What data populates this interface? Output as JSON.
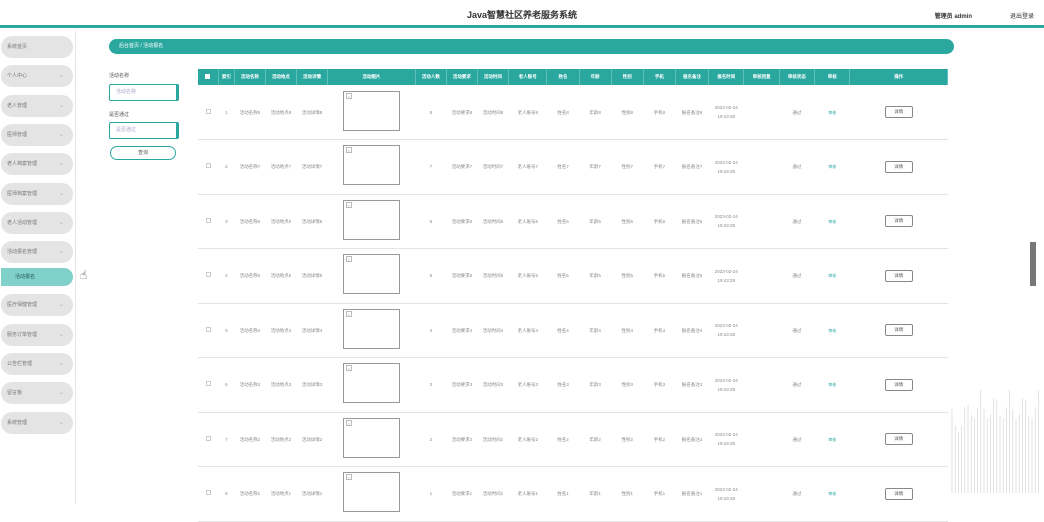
{
  "header": {
    "title": "Java智慧社区养老服务系统",
    "user": "管理员 admin",
    "logout": "退出登录"
  },
  "sidebar": {
    "items": [
      {
        "label": "系统首页",
        "chev": ""
      },
      {
        "label": "个人中心",
        "chev": "⌄"
      },
      {
        "label": "老人管理",
        "chev": "⌄"
      },
      {
        "label": "医师管理",
        "chev": "⌄"
      },
      {
        "label": "老人档案管理",
        "chev": "⌄"
      },
      {
        "label": "医师档案管理",
        "chev": "⌄"
      },
      {
        "label": "老人活动管理",
        "chev": "⌄"
      },
      {
        "label": "活动报名管理",
        "chev": "⌄"
      }
    ],
    "active_sub": "活动报名",
    "items_after": [
      {
        "label": "医疗保健管理",
        "chev": "⌄"
      },
      {
        "label": "服务订单管理",
        "chev": "⌄"
      },
      {
        "label": "公告栏管理",
        "chev": "⌄"
      },
      {
        "label": "留言板",
        "chev": "⌄"
      },
      {
        "label": "系统管理",
        "chev": "⌄"
      }
    ]
  },
  "breadcrumb": "后台首页 / 活动报名",
  "filters": {
    "name_label": "活动名称",
    "name_placeholder": "活动名称",
    "approved_label": "是否通过",
    "approved_placeholder": "是否通过",
    "search_button": "查询"
  },
  "table": {
    "headers": [
      "",
      "索引",
      "活动名称",
      "活动地点",
      "活动详情",
      "活动图片",
      "活动人数",
      "活动要求",
      "活动时间",
      "老人账号",
      "姓名",
      "年龄",
      "性别",
      "手机",
      "报名备注",
      "报名时间",
      "审核回复",
      "审核状态",
      "审核",
      "操作"
    ],
    "rows": [
      {
        "index": "1",
        "name": "活动名称8",
        "place": "活动地点8",
        "detail": "活动详情8",
        "count": "8",
        "req": "活动要求8",
        "time": "活动时间8",
        "account": "老人账号8",
        "person": "姓名8",
        "age": "年龄8",
        "gender": "性别8",
        "phone": "手机8",
        "remark": "报名备注8",
        "signup": "2023-02-24 19:43:28",
        "reply": "",
        "status": "通过",
        "review": "审核",
        "action": "详情"
      },
      {
        "index": "2",
        "name": "活动名称7",
        "place": "活动地点7",
        "detail": "活动详情7",
        "count": "7",
        "req": "活动要求7",
        "time": "活动时间7",
        "account": "老人账号7",
        "person": "姓名7",
        "age": "年龄7",
        "gender": "性别7",
        "phone": "手机7",
        "remark": "报名备注7",
        "signup": "2023-02-24 19:43:28",
        "reply": "",
        "status": "通过",
        "review": "审核",
        "action": "详情"
      },
      {
        "index": "3",
        "name": "活动名称6",
        "place": "活动地点6",
        "detail": "活动详情6",
        "count": "6",
        "req": "活动要求6",
        "time": "活动时间6",
        "account": "老人账号6",
        "person": "姓名6",
        "age": "年龄6",
        "gender": "性别6",
        "phone": "手机6",
        "remark": "报名备注6",
        "signup": "2023-02-24 19:43:28",
        "reply": "",
        "status": "通过",
        "review": "审核",
        "action": "详情"
      },
      {
        "index": "4",
        "name": "活动名称5",
        "place": "活动地点5",
        "detail": "活动详情5",
        "count": "5",
        "req": "活动要求5",
        "time": "活动时间5",
        "account": "老人账号5",
        "person": "姓名5",
        "age": "年龄5",
        "gender": "性别5",
        "phone": "手机5",
        "remark": "报名备注5",
        "signup": "2023-02-24 19:43:28",
        "reply": "",
        "status": "通过",
        "review": "审核",
        "action": "详情"
      },
      {
        "index": "5",
        "name": "活动名称4",
        "place": "活动地点4",
        "detail": "活动详情4",
        "count": "4",
        "req": "活动要求4",
        "time": "活动时间4",
        "account": "老人账号4",
        "person": "姓名4",
        "age": "年龄4",
        "gender": "性别4",
        "phone": "手机4",
        "remark": "报名备注4",
        "signup": "2023-02-24 19:43:28",
        "reply": "",
        "status": "通过",
        "review": "审核",
        "action": "详情"
      },
      {
        "index": "6",
        "name": "活动名称3",
        "place": "活动地点3",
        "detail": "活动详情3",
        "count": "3",
        "req": "活动要求3",
        "time": "活动时间3",
        "account": "老人账号3",
        "person": "姓名3",
        "age": "年龄3",
        "gender": "性别3",
        "phone": "手机3",
        "remark": "报名备注3",
        "signup": "2023-02-24 19:43:28",
        "reply": "",
        "status": "通过",
        "review": "审核",
        "action": "详情"
      },
      {
        "index": "7",
        "name": "活动名称2",
        "place": "活动地点2",
        "detail": "活动详情2",
        "count": "2",
        "req": "活动要求2",
        "time": "活动时间2",
        "account": "老人账号2",
        "person": "姓名2",
        "age": "年龄2",
        "gender": "性别2",
        "phone": "手机2",
        "remark": "报名备注2",
        "signup": "2023-02-24 19:43:28",
        "reply": "",
        "status": "通过",
        "review": "审核",
        "action": "详情"
      },
      {
        "index": "8",
        "name": "活动名称1",
        "place": "活动地点1",
        "detail": "活动详情1",
        "count": "1",
        "req": "活动要求1",
        "time": "活动时间1",
        "account": "老人账号1",
        "person": "姓名1",
        "age": "年龄1",
        "gender": "性别1",
        "phone": "手机1",
        "remark": "报名备注1",
        "signup": "2023-02-24 19:43:28",
        "reply": "",
        "status": "通过",
        "review": "审核",
        "action": "详情"
      }
    ]
  },
  "colors": {
    "accent": "#2aa8a0",
    "active_sub_bg": "#7fd1c9",
    "sidebar_item_bg": "#e4e4e4"
  }
}
